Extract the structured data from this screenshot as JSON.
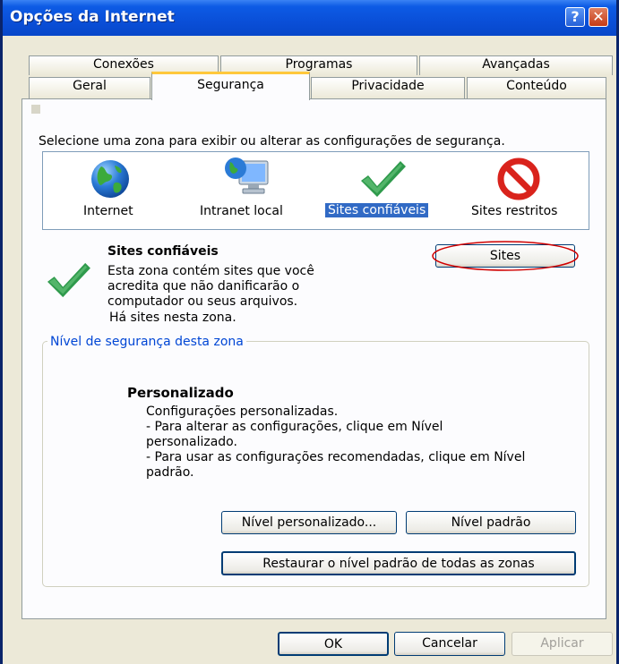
{
  "window": {
    "title": "Opções da Internet"
  },
  "tabs": {
    "row_back": [
      "Conexões",
      "Programas",
      "Avançadas"
    ],
    "row_front": [
      "Geral",
      "Segurança",
      "Privacidade",
      "Conteúdo"
    ],
    "active": "Segurança"
  },
  "zones": {
    "instruction": "Selecione uma zona para exibir ou alterar as configurações de segurança.",
    "items": [
      {
        "label": "Internet",
        "icon": "globe-icon"
      },
      {
        "label": "Intranet local",
        "icon": "computer-globe-icon"
      },
      {
        "label": "Sites confiáveis",
        "icon": "checkmark-icon",
        "selected": true
      },
      {
        "label": "Sites restritos",
        "icon": "restricted-icon"
      }
    ]
  },
  "zone_info": {
    "title": "Sites confiáveis",
    "description": [
      "Esta zona contém sites que você",
      "acredita que não danificarão o",
      "computador ou seus arquivos."
    ],
    "sites_note": "Há sites nesta zona.",
    "sites_button": "Sites"
  },
  "security_level": {
    "legend": "Nível de segurança desta zona",
    "level_name": "Personalizado",
    "lines": [
      "Configurações personalizadas.",
      "- Para alterar as configurações, clique em Nível",
      "personalizado.",
      "- Para usar as configurações recomendadas, clique em Nível",
      "padrão."
    ],
    "custom_button": "Nível personalizado...",
    "default_button": "Nível padrão",
    "reset_all_button": "Restaurar o nível padrão de todas as zonas"
  },
  "footer": {
    "ok": "OK",
    "cancel": "Cancelar",
    "apply": "Aplicar"
  },
  "colors": {
    "titlebar": "#0A4FD8",
    "selection": "#316AC5",
    "highlight_ellipse": "#D00000",
    "legend_text": "#0046D5",
    "tab_accent": "#FFC83C"
  }
}
